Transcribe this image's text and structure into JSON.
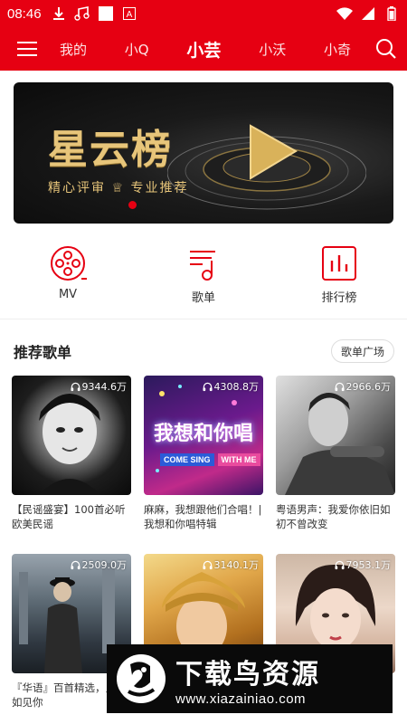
{
  "status_bar": {
    "time": "08:46",
    "icons": [
      "download-icon",
      "music-icon",
      "blank-icon",
      "a-icon",
      "wifi-icon",
      "signal-icon",
      "battery-icon"
    ]
  },
  "nav": {
    "tabs": [
      {
        "label": "我的"
      },
      {
        "label": "小Q"
      },
      {
        "label": "小芸"
      },
      {
        "label": "小沃"
      },
      {
        "label": "小奇"
      }
    ],
    "active_tab": "小芸"
  },
  "banner": {
    "title": "星云榜",
    "subtitle": "精心评审 ♕ 专业推荐"
  },
  "quick_entries": [
    {
      "label": "MV",
      "icon": "film-reel-icon"
    },
    {
      "label": "歌单",
      "icon": "playlist-icon"
    },
    {
      "label": "排行榜",
      "icon": "chart-icon"
    }
  ],
  "section": {
    "title": "推荐歌单",
    "more_label": "歌单广场"
  },
  "playlists": [
    {
      "count": "9344.6万",
      "title": "【民谣盛宴】100首必听欧美民谣"
    },
    {
      "count": "4308.8万",
      "title": "麻麻，我想跟他们合唱！| 我想和你唱特辑",
      "cover_text": "我想和你唱",
      "cover_sub1": "COME SING",
      "cover_sub2": "WITH ME"
    },
    {
      "count": "2966.6万",
      "title": "粤语男声：我爱你依旧如初不曾改变"
    },
    {
      "count": "2509.0万",
      "title": "『华语』百首精选，只想如见你"
    },
    {
      "count": "3140.1万",
      "title": ""
    },
    {
      "count": "7953.1万",
      "title": ""
    }
  ],
  "watermark": {
    "title": "下载鸟资源",
    "url": "www.xiazainiao.com"
  },
  "colors": {
    "brand_red": "#e60012",
    "banner_gold": "#e7c57a"
  }
}
